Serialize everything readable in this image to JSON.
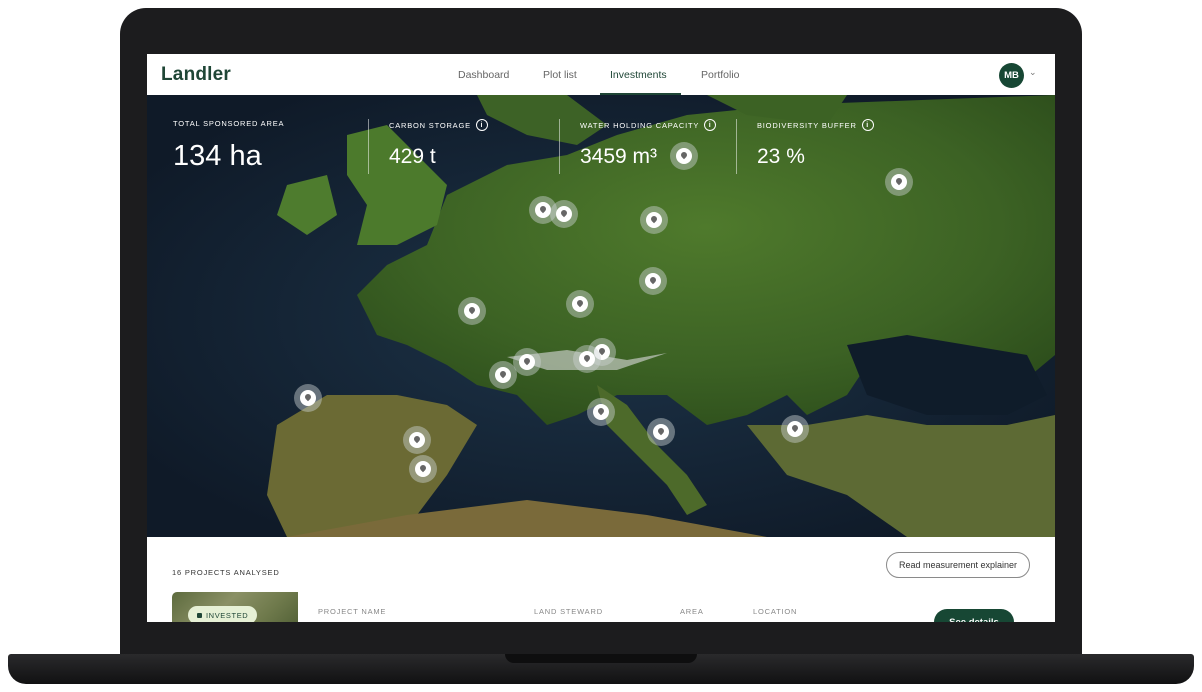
{
  "app": {
    "logo": "Landler"
  },
  "nav": {
    "items": [
      {
        "label": "Dashboard"
      },
      {
        "label": "Plot list"
      },
      {
        "label": "Investments",
        "active": true
      },
      {
        "label": "Portfolio"
      }
    ],
    "avatar_initials": "MB"
  },
  "stats": [
    {
      "label": "TOTAL SPONSORED AREA",
      "value": "134 ha"
    },
    {
      "label": "CARBON STORAGE",
      "value": "429 t"
    },
    {
      "label": "WATER HOLDING CAPACITY",
      "value": "3459 m³"
    },
    {
      "label": "BIODIVERSITY BUFFER",
      "value": "23 %"
    }
  ],
  "map": {
    "marker_icon": "map-pin-icon"
  },
  "panel": {
    "projects_count": "16 PROJECTS ANALYSED",
    "explainer_button": "Read measurement explainer",
    "columns": [
      "PROJECT NAME",
      "LAND STEWARD",
      "AREA",
      "LOCATION"
    ],
    "first_project": {
      "badge": "INVESTED",
      "action": "See details"
    }
  },
  "colors": {
    "brand": "#1f4636",
    "button": "#174734",
    "badge_bg": "#e6f0d5"
  }
}
